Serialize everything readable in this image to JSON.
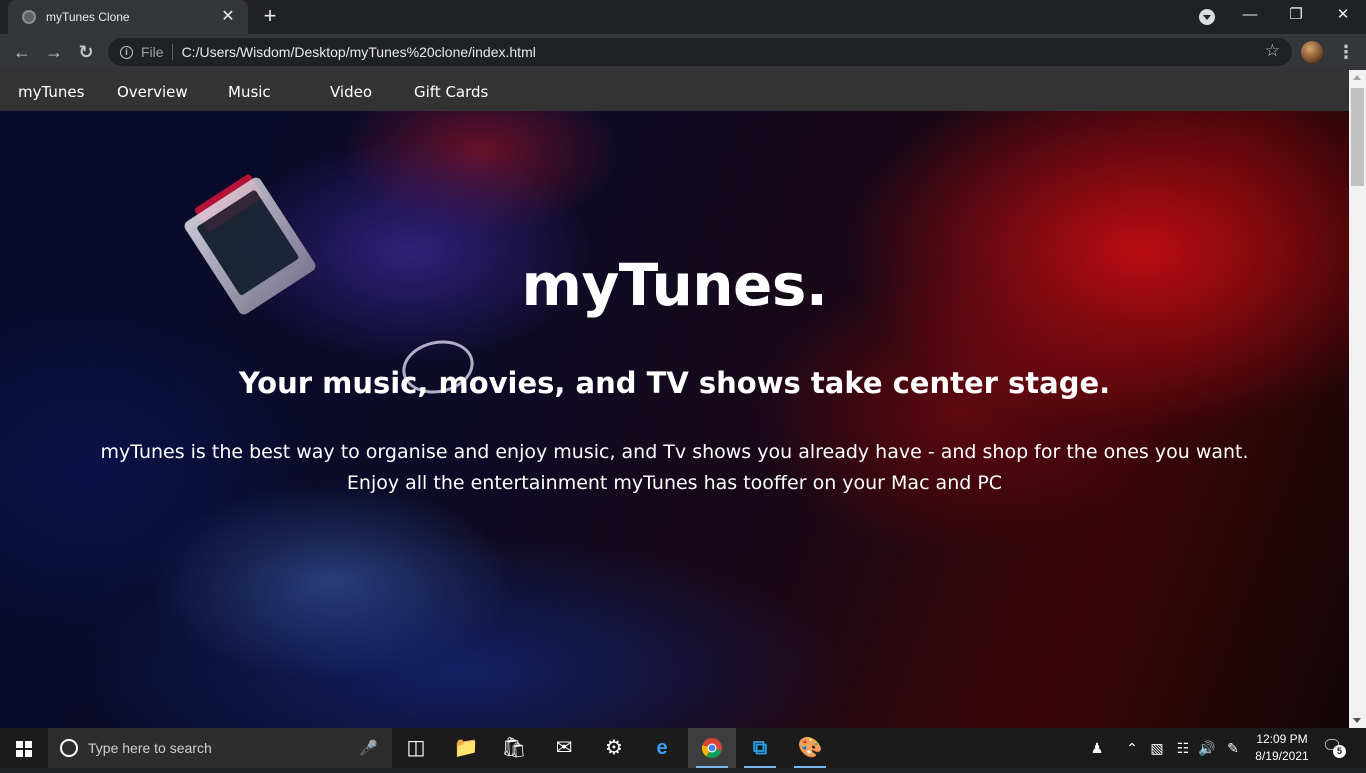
{
  "browser": {
    "tab_title": "myTunes Clone",
    "tab_close": "✕",
    "new_tab": "+",
    "address": {
      "scheme_label": "File",
      "url": "C:/Users/Wisdom/Desktop/myTunes%20clone/index.html"
    },
    "icons": [
      "back-arrow-icon",
      "forward-arrow-icon",
      "reload-icon",
      "info-icon",
      "bookmark-star-icon",
      "profile-avatar",
      "more-menu-icon",
      "minimize-icon",
      "restore-icon",
      "close-icon"
    ]
  },
  "site": {
    "nav": {
      "brand": "myTunes",
      "items": [
        "Overview",
        "Music",
        "Video",
        "Gift Cards"
      ]
    },
    "hero": {
      "title": "myTunes.",
      "subtitle": "Your music, movies, and TV shows take center stage.",
      "text": "myTunes is the best way to organise and enjoy music, and Tv shows you already have - and shop for the ones you want. Enjoy all the entertainment myTunes has tooffer on your Mac and PC"
    },
    "colors": {
      "nav_bg": "#333333",
      "hero_red": "#c80c12",
      "hero_blue": "#141e78"
    }
  },
  "taskbar": {
    "search_placeholder": "Type here to search",
    "apps": [
      "task-view-icon",
      "file-explorer-icon",
      "microsoft-store-icon",
      "mail-icon",
      "settings-icon",
      "edge-icon",
      "chrome-icon",
      "vscode-icon",
      "paint-icon"
    ],
    "clock": {
      "time": "12:09 PM",
      "date": "8/19/2021"
    },
    "notification_count": "5"
  }
}
